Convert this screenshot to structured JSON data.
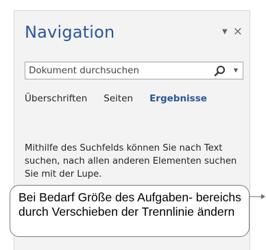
{
  "pane": {
    "title": "Navigation",
    "close_glyph": "×",
    "options_glyph": "▼"
  },
  "search": {
    "placeholder": "Dokument durchsuchen",
    "icon": "search-icon",
    "dropdown_icon": "chevron-down-icon"
  },
  "tabs": [
    {
      "label": "Überschriften",
      "active": false
    },
    {
      "label": "Seiten",
      "active": false
    },
    {
      "label": "Ergebnisse",
      "active": true
    }
  ],
  "body": {
    "text": "Mithilfe des Suchfelds können Sie nach Text suchen, nach allen anderen Elementen suchen Sie mit der Lupe."
  },
  "callout": {
    "text": "Bei Bedarf Größe des Aufgaben- bereichs durch Verschieben der Trennlinie ändern"
  },
  "colors": {
    "accent": "#2b579a",
    "pane_bg": "#f3f3f3"
  }
}
